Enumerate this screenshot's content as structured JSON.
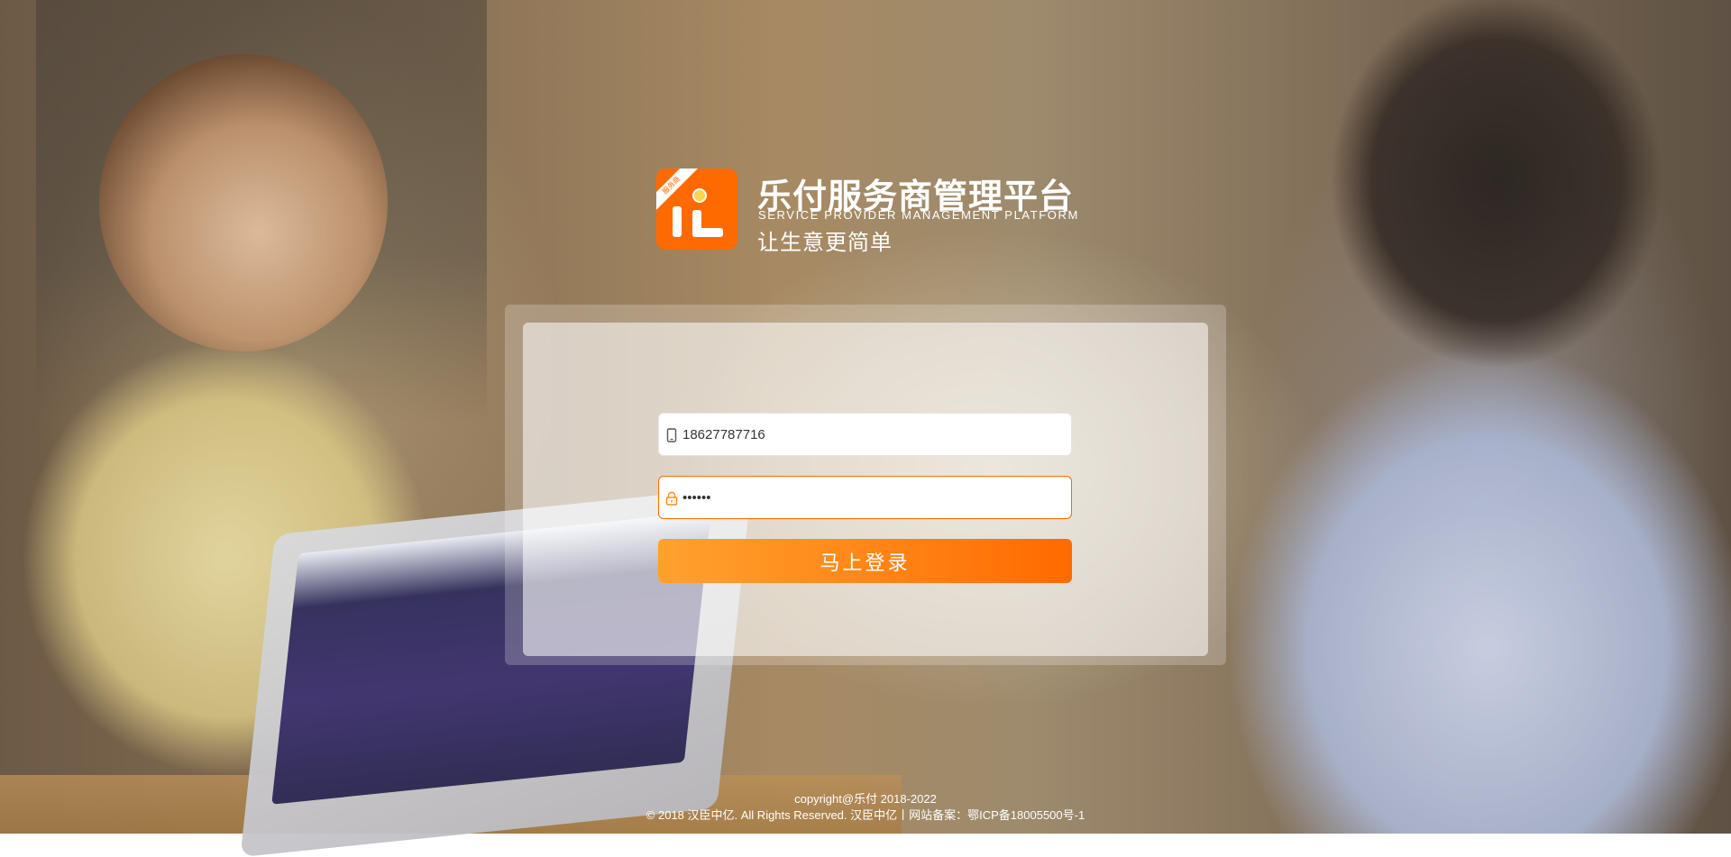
{
  "brand": {
    "icon_ribbon": "服务商",
    "title": "乐付服务商管理平台",
    "subtitle": "SERVICE PROVIDER MANAGEMENT PLATFORM",
    "slogan": "让生意更简单"
  },
  "login_form": {
    "phone_value": "18627787716",
    "password_value": "••••••",
    "phone_icon": "mobile-phone-icon",
    "password_icon": "lock-icon",
    "submit_label": "马上登录"
  },
  "colors": {
    "accent": "#ff6a00",
    "button_gradient_start": "#ffa12e",
    "button_gradient_end": "#ff6a00"
  },
  "footer": {
    "copyright": "copyright@乐付 2018-2022",
    "rights": "© 2018 汉臣中亿. All Rights Reserved. 汉臣中亿丨网站备案：鄂ICP备18005500号-1"
  }
}
